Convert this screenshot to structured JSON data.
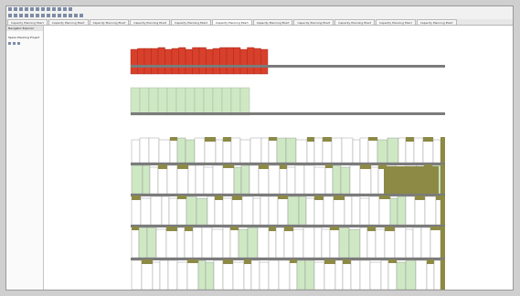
{
  "window": {
    "tabs": [
      {
        "label": "Capacity Planning Ekart"
      },
      {
        "label": "Capacity Planning Ekart"
      },
      {
        "label": "Capacity Planning Ekart"
      },
      {
        "label": "Capacity Planning Ekart"
      },
      {
        "label": "Capacity Planning Ekart"
      },
      {
        "label": "Capacity Planning Ekart"
      },
      {
        "label": "Capacity Planning Ekart"
      },
      {
        "label": "Capacity Planning Ekart"
      },
      {
        "label": "Capacity Planning Ekart"
      },
      {
        "label": "Capacity Planning Ekart"
      },
      {
        "label": "Capacity Planning Ekart"
      }
    ],
    "active_tab_index": 5
  },
  "navigator": {
    "title": "Navigator Explorer",
    "items": [
      {
        "label": "Space Planning Project"
      }
    ]
  },
  "colors": {
    "occupied_red": "#d8402c",
    "highlight_green": "#cfe8c4",
    "olive_fill": "#8c8a45",
    "shelf_gray": "#7b7b7b"
  },
  "icons": [
    "file-icon",
    "save-icon",
    "undo-icon",
    "redo-icon",
    "zoom-icon",
    "grid-icon",
    "shelf-icon",
    "product-icon"
  ]
}
